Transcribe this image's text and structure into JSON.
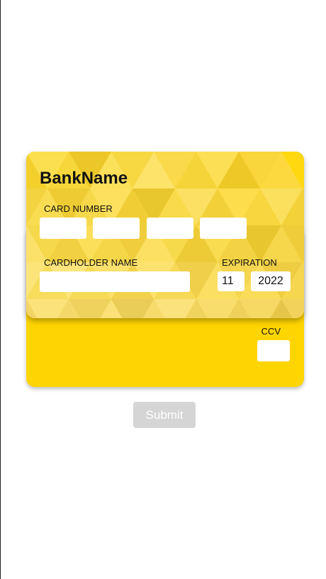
{
  "card": {
    "bank_name": "BankName",
    "card_number_label": "CARD NUMBER",
    "cardholder_label": "CARDHOLDER NAME",
    "expiration_label": "EXPIRATION",
    "expiration_month": "11",
    "expiration_year": "2022",
    "ccv_label": "CCV",
    "card_number_segments": [
      "",
      "",
      "",
      ""
    ],
    "cardholder_value": "",
    "ccv_value": ""
  },
  "form": {
    "submit_label": "Submit"
  },
  "colors": {
    "card_yellow": "#ffd500",
    "submit_disabled": "#d5d5d5"
  }
}
